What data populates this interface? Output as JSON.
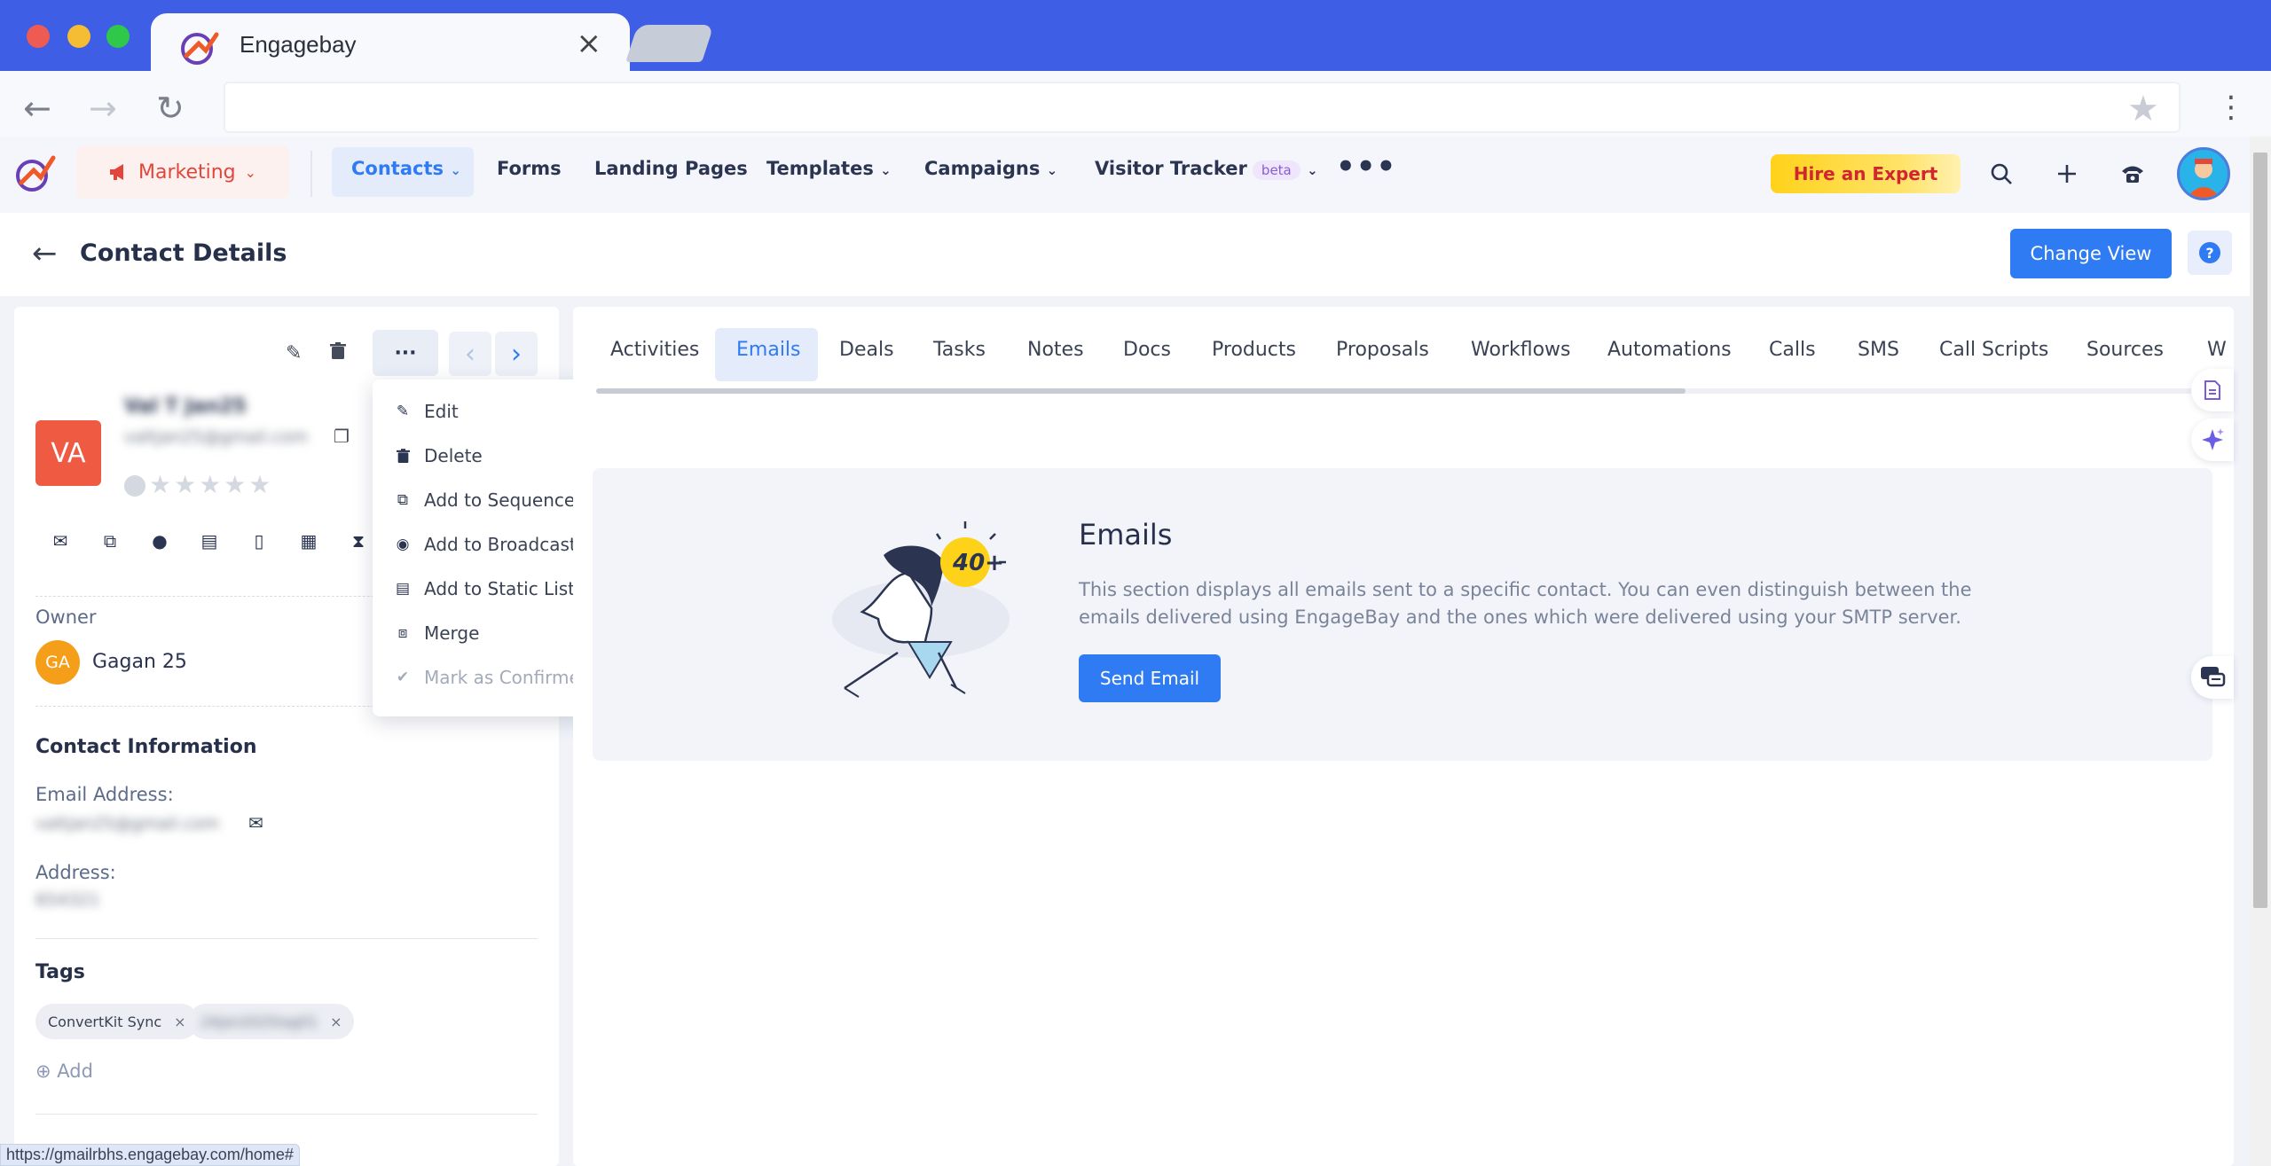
{
  "browser": {
    "tab_title": "Engagebay",
    "tab_close": "×",
    "status_url": "https://gmailrbhs.engagebay.com/home#"
  },
  "header": {
    "module": "Marketing",
    "nav": [
      {
        "label": "Contacts",
        "caret": true
      },
      {
        "label": "Forms"
      },
      {
        "label": "Landing Pages"
      },
      {
        "label": "Templates",
        "caret": true
      },
      {
        "label": "Campaigns",
        "caret": true
      },
      {
        "label": "Visitor Tracker",
        "badge": "beta",
        "caret": true
      }
    ],
    "more": "•••",
    "hire_expert": "Hire an Expert"
  },
  "page": {
    "title": "Contact Details",
    "change_view": "Change View",
    "help": "?"
  },
  "contact": {
    "initials": "VA",
    "name": "Val T Jan25",
    "email": "valtjan25@gmail.com",
    "owner_label": "Owner",
    "owner_initials": "GA",
    "owner_name": "Gagan 25",
    "contact_info_title": "Contact Information",
    "email_label": "Email Address:",
    "email_value": "valtjan25@gmail.com",
    "address_label": "Address:",
    "address_value": "654321",
    "tags_title": "Tags",
    "tags": [
      "ConvertKit Sync",
      "24jan2025tag01"
    ],
    "add_label": "Add"
  },
  "more_menu": [
    {
      "label": "Edit",
      "icon": "pencil-icon",
      "enabled": true
    },
    {
      "label": "Delete",
      "icon": "trash-icon",
      "enabled": true
    },
    {
      "label": "Add to Sequences",
      "icon": "sequence-icon",
      "enabled": true
    },
    {
      "label": "Add to Broadcast",
      "icon": "broadcast-icon",
      "enabled": true
    },
    {
      "label": "Add to Static List",
      "icon": "list-add-icon",
      "enabled": true
    },
    {
      "label": "Merge",
      "icon": "merge-icon",
      "enabled": true
    },
    {
      "label": "Mark as Confirmed",
      "icon": "check-circle-icon",
      "enabled": false
    }
  ],
  "tabs": [
    "Activities",
    "Emails",
    "Deals",
    "Tasks",
    "Notes",
    "Docs",
    "Products",
    "Proposals",
    "Workflows",
    "Automations",
    "Calls",
    "SMS",
    "Call Scripts",
    "Sources",
    "W"
  ],
  "active_tab": "Emails",
  "emails_section": {
    "badge": "40+",
    "title": "Emails",
    "description": "This section displays all emails sent to a specific contact. You can even distinguish between the emails delivered using EngageBay and the ones which were delivered using your SMTP server.",
    "send_button": "Send Email"
  },
  "colors": {
    "primary": "#2f7bf3",
    "brand_red": "#e2463b",
    "chrome_blue": "#3f5ee6",
    "avatar_red": "#ef5a43",
    "owner_orange": "#f59e1a"
  }
}
